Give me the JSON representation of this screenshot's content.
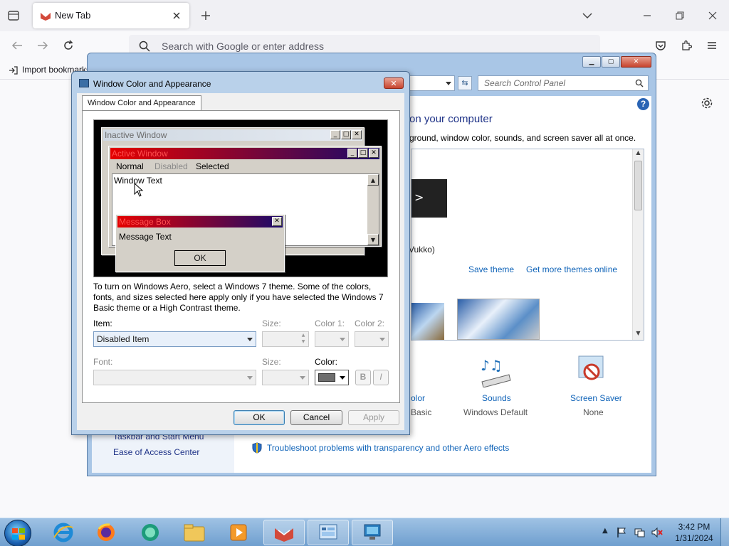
{
  "browser": {
    "tab_title": "New Tab",
    "url_placeholder": "Search with Google or enter address",
    "bookmark_import": "Import bookmarks..."
  },
  "control_panel": {
    "search_placeholder": "Search Control Panel",
    "heading_partial": "on your computer",
    "subheading_partial": "ground, window color, sounds, and screen saver all at once.",
    "theme_owner_partial": "Vukko)",
    "save_theme": "Save theme",
    "get_more_themes": "Get more themes online",
    "window_color_partial": "olor",
    "window_color_value_partial": "Basic",
    "sounds_label": "Sounds",
    "sounds_value": "Windows Default",
    "screensaver_label": "Screen Saver",
    "screensaver_value": "None",
    "left_link_1": "Taskbar and Start Menu",
    "left_link_2": "Ease of Access Center",
    "troubleshoot": "Troubleshoot problems with transparency and other Aero effects"
  },
  "dialog": {
    "title": "Window Color and Appearance",
    "tab": "Window Color and Appearance",
    "preview": {
      "inactive_title": "Inactive Window",
      "active_title": "Active Window",
      "menu_normal": "Normal",
      "menu_disabled": "Disabled",
      "menu_selected": "Selected",
      "window_text": "Window Text",
      "msgbox_title": "Message Box",
      "msgbox_text": "Message Text",
      "msgbox_ok": "OK"
    },
    "info": "To turn on Windows Aero, select a Windows 7 theme.  Some of the colors, fonts, and sizes selected here apply only if you have selected the Windows 7 Basic theme or a High Contrast theme.",
    "item_label": "Item:",
    "item_value": "Disabled Item",
    "size_label": "Size:",
    "color1_label": "Color 1:",
    "color2_label": "Color 2:",
    "font_label": "Font:",
    "font_size_label": "Size:",
    "color_label": "Color:",
    "bold_btn": "B",
    "italic_btn": "I",
    "ok": "OK",
    "cancel": "Cancel",
    "apply": "Apply",
    "swatch_color": "#6d6d6d"
  },
  "taskbar": {
    "time": "3:42 PM",
    "date": "1/31/2024"
  }
}
